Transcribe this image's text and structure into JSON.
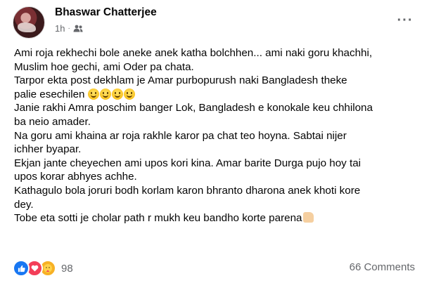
{
  "post": {
    "author": "Bhaswar Chatterjee",
    "time": "1h",
    "audience_icon": "friends-icon",
    "lines": [
      "Ami roja rekhechi bole aneke anek katha bolchhen... ami naki goru khachhi,",
      "Muslim hoe gechi, ami Oder pa chata.",
      "Tarpor ekta post dekhlam je Amar purbopurush naki Bangladesh theke",
      "palie esechilen",
      "Janie rakhi Amra poschim banger Lok, Bangladesh e konokale keu chhilona",
      "ba neio amader.",
      "Na goru ami khaina ar roja rakhle karor pa chat teo hoyna. Sabtai nijer",
      "ichher byapar.",
      "Ekjan jante cheyechen ami upos kori kina. Amar barite Durga pujo hoy  tai",
      "upos korar abhyes achhe.",
      "Kathagulo bola joruri bodh korlam karon bhranto dharona anek khoti kore",
      "dey.",
      "Tobe eta sotti je cholar path r mukh keu bandho korte parena"
    ]
  },
  "footer": {
    "reaction_count": "98",
    "comments": "66 Comments",
    "reactions": [
      "like-icon",
      "love-icon",
      "care-icon"
    ]
  },
  "colors": {
    "like": "#1877f2",
    "love": "#f33e58",
    "care": "#f7b125",
    "meta_text": "#65676b"
  }
}
